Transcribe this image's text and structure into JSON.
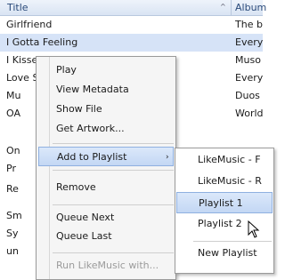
{
  "list": {
    "columns": {
      "title": "Title",
      "album": "Album"
    },
    "rows": [
      {
        "title": "Girlfriend",
        "album": "The b"
      },
      {
        "title": "I Gotta Feeling",
        "album": "Every"
      },
      {
        "title": "I Kissed A Girl",
        "album": "Muso"
      },
      {
        "title": "Love Story",
        "album": "Every"
      },
      {
        "title": "Mu",
        "album": "Duos"
      },
      {
        "title": "OA",
        "album": "World"
      },
      {
        "title": "On",
        "album": ""
      },
      {
        "title": "Pr",
        "album": ""
      },
      {
        "title": "Re",
        "album": ""
      },
      {
        "title": "Sm",
        "album": ""
      },
      {
        "title": "Sy",
        "album": ""
      },
      {
        "title": "un",
        "album": ""
      }
    ]
  },
  "context_menu": {
    "items": [
      {
        "label": "Play",
        "enabled": true
      },
      {
        "label": "View Metadata",
        "enabled": true
      },
      {
        "label": "Show File",
        "enabled": true
      },
      {
        "label": "Get Artwork...",
        "enabled": true
      },
      {
        "label": "Add to Playlist",
        "enabled": true,
        "submenu_arrow": "›"
      },
      {
        "label": "Remove",
        "enabled": true
      },
      {
        "label": "Queue Next",
        "enabled": true
      },
      {
        "label": "Queue Last",
        "enabled": true
      },
      {
        "label": "Run LikeMusic with...",
        "enabled": false
      }
    ]
  },
  "submenu": {
    "items": [
      {
        "label": "LikeMusic - F"
      },
      {
        "label": "LikeMusic - R"
      },
      {
        "label": "Playlist 1"
      },
      {
        "label": "Playlist 2"
      },
      {
        "label": "New Playlist"
      }
    ]
  },
  "colors": {
    "selection": "#d6e3f7",
    "hover_highlight": "#c3d7f4",
    "header_text": "#2a4a7a"
  },
  "icons": {
    "sort_indicator": "chevron-up-icon",
    "submenu_indicator": "chevron-right-icon",
    "pointer": "mouse-cursor-icon"
  }
}
